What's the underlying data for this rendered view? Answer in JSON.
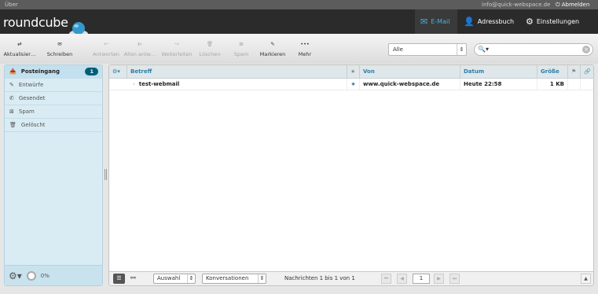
{
  "topbar": {
    "about": "Über",
    "user": "info@quick-webspace.de",
    "logout": "Abmelden"
  },
  "header": {
    "logo": "roundcube",
    "nav": [
      {
        "label": "E-Mail",
        "icon": "mail-icon"
      },
      {
        "label": "Adressbuch",
        "icon": "person-icon"
      },
      {
        "label": "Einstellungen",
        "icon": "gear-icon"
      }
    ]
  },
  "toolbar": {
    "buttons": [
      "Aktualisier…",
      "Schreiben",
      "Antworten",
      "Allen antw…",
      "Weiterleiten",
      "Löschen",
      "Spam",
      "Markieren",
      "Mehr"
    ]
  },
  "filter": {
    "value": "Alle"
  },
  "search": {
    "placeholder": ""
  },
  "folders": [
    {
      "label": "Posteingang",
      "unread": "1"
    },
    {
      "label": "Entwürfe"
    },
    {
      "label": "Gesendet"
    },
    {
      "label": "Spam"
    },
    {
      "label": "Gelöscht"
    }
  ],
  "quota": {
    "label": "0%"
  },
  "columns": {
    "subject": "Betreff",
    "from": "Von",
    "date": "Datum",
    "size": "Größe"
  },
  "messages": [
    {
      "subject": "test-webmail",
      "from": "www.quick-webspace.de",
      "date": "Heute 22:58",
      "size": "1 KB"
    }
  ],
  "footer": {
    "select": "Auswahl",
    "threads": "Konversationen",
    "count": "Nachrichten 1 bis 1 von 1",
    "page": "1"
  },
  "colors": {
    "accent": "#3fb2e8",
    "badge": "#005d76",
    "sidebar": "#d9ecf4"
  }
}
